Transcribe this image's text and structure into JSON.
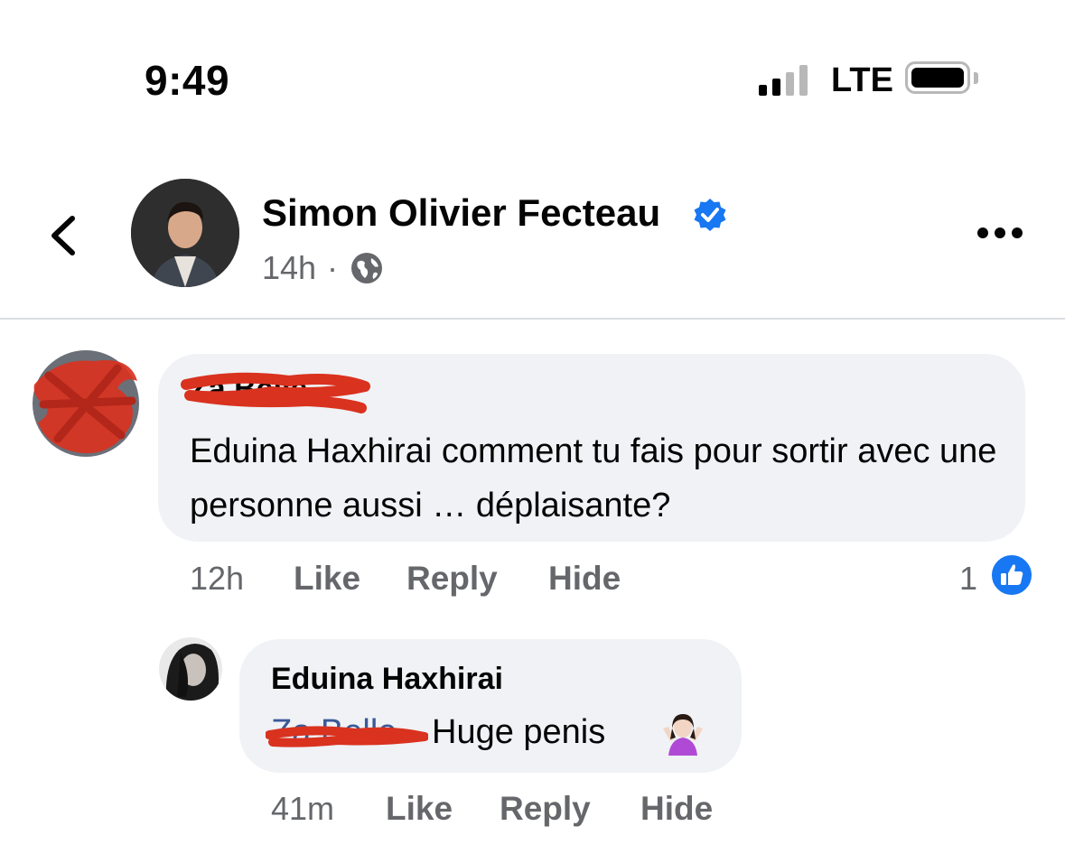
{
  "status_bar": {
    "time": "9:49",
    "network": "LTE"
  },
  "post": {
    "author": "Simon Olivier Fecteau",
    "time": "14h",
    "separator": "·"
  },
  "comments": [
    {
      "author": "Za Belle",
      "text": "Eduina Haxhirai comment tu fais pour sortir avec une personne aussi … déplaisante?",
      "time": "12h",
      "like_label": "Like",
      "reply_label": "Reply",
      "hide_label": "Hide",
      "reaction_count": "1"
    },
    {
      "author": "Eduina Haxhirai",
      "mention": "Za Belle",
      "text": "Huge penis",
      "time": "41m",
      "like_label": "Like",
      "reply_label": "Reply",
      "hide_label": "Hide"
    }
  ],
  "colors": {
    "accent": "#1877f2",
    "secondary_text": "#65676b",
    "bubble": "#f0f2f5",
    "redaction": "#d9321f"
  },
  "icons": [
    "signal-icon",
    "battery-icon",
    "back-chevron-icon",
    "verified-badge-icon",
    "globe-icon",
    "more-options-icon",
    "like-reaction-icon",
    "shrug-emoji-icon"
  ]
}
